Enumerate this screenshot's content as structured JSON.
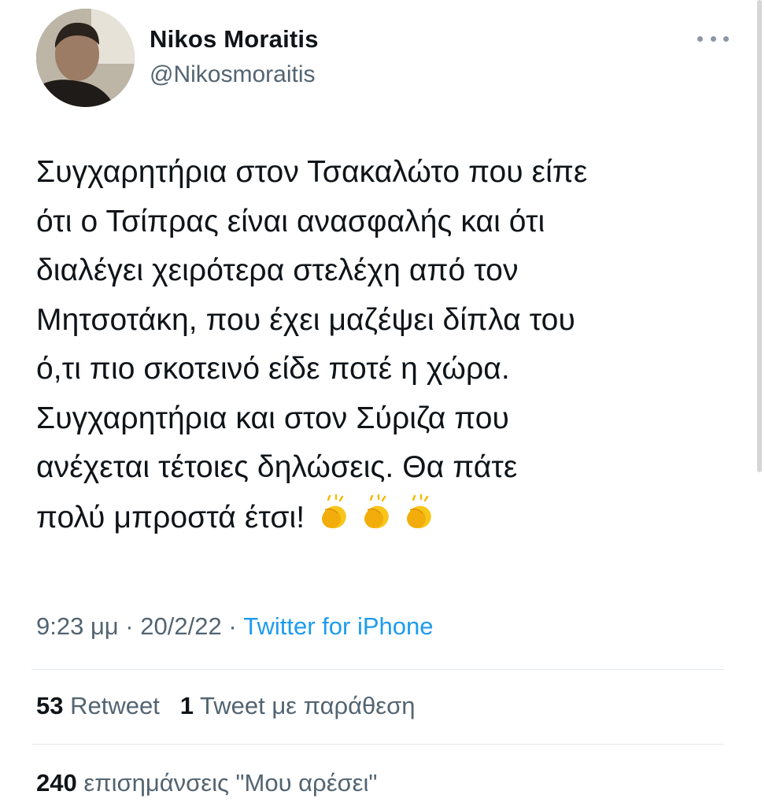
{
  "tweet": {
    "author": {
      "display_name": "Nikos Moraitis",
      "handle": "@Nikosmoraitis"
    },
    "text_lines": [
      "Συγχαρητήρια στον Τσακαλώτο που είπε",
      "ότι ο Τσίπρας είναι ανασφαλής και ότι",
      "διαλέγει χειρότερα στελέχη από τον",
      "Μητσοτάκη, που έχει μαζέψει δίπλα του",
      "ό,τι πιο σκοτεινό είδε ποτέ η χώρα.",
      "Συγχαρητήρια και στον Σύριζα που",
      "ανέχεται τέτοιες δηλώσεις. Θα πάτε",
      "πολύ μπροστά έτσι!"
    ],
    "emoji": [
      "clapping-hands",
      "clapping-hands",
      "clapping-hands"
    ],
    "time": "9:23 μμ",
    "separator": "·",
    "date": "20/2/22",
    "source": "Twitter for iPhone",
    "retweets": {
      "count": "53",
      "label": "Retweet"
    },
    "quote_tweets": {
      "count": "1",
      "label": "Tweet με παράθεση"
    },
    "likes": {
      "count": "240",
      "label": "επισημάνσεις \"Μου αρέσει\""
    }
  },
  "colors": {
    "text_primary": "#0f1419",
    "text_secondary": "#536471",
    "link": "#1d9bf0",
    "divider": "#e1e8ed"
  },
  "icons": {
    "more": "more-horizontal-icon",
    "emoji": "clapping-hands-emoji"
  }
}
